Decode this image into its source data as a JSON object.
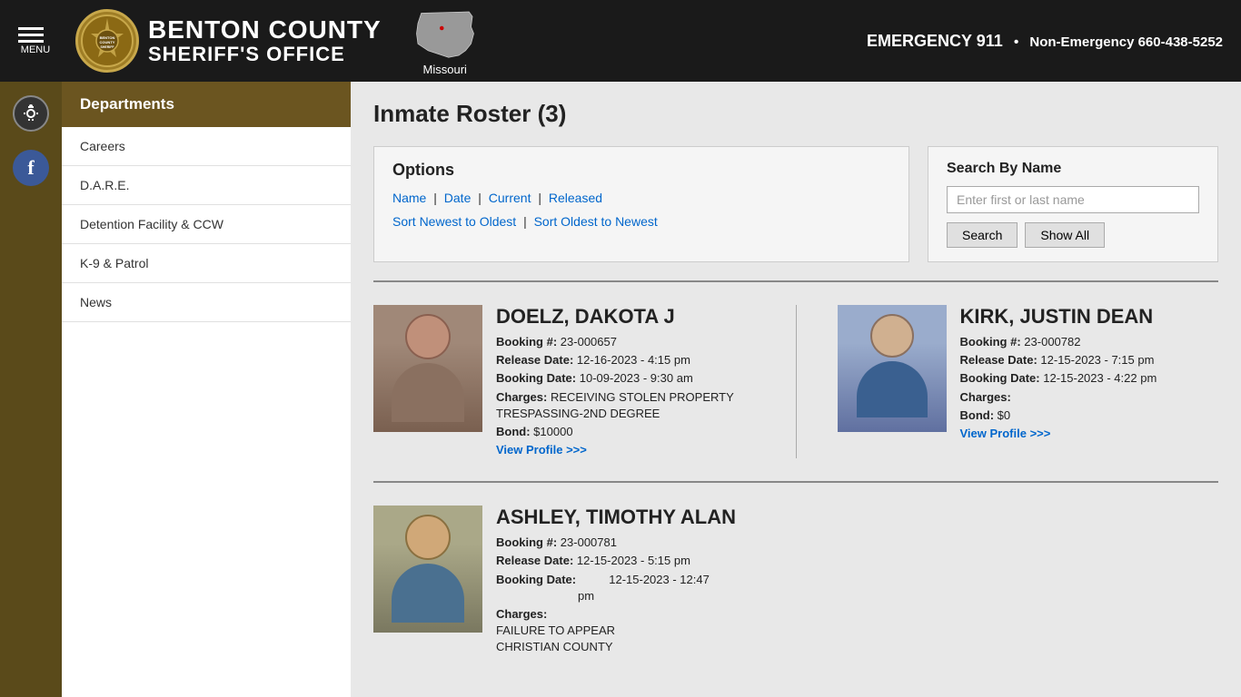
{
  "header": {
    "title_line1": "BENTON COUNTY",
    "title_line2": "SHERIFF'S OFFICE",
    "state": "Missouri",
    "emergency_label": "EMERGENCY 911",
    "separator": "•",
    "non_emergency_label": "Non-Emergency 660-438-5252",
    "menu_label": "MENU"
  },
  "sidebar": {
    "departments_label": "Departments",
    "items": [
      {
        "label": "Careers",
        "href": "#"
      },
      {
        "label": "D.A.R.E.",
        "href": "#"
      },
      {
        "label": "Detention Facility & CCW",
        "href": "#"
      },
      {
        "label": "K-9 & Patrol",
        "href": "#"
      },
      {
        "label": "News",
        "href": "#"
      }
    ]
  },
  "main": {
    "page_title": "Inmate Roster (3)",
    "options": {
      "heading": "Options",
      "links": [
        {
          "label": "Name",
          "href": "#"
        },
        {
          "label": "Date",
          "href": "#"
        },
        {
          "label": "Current",
          "href": "#"
        },
        {
          "label": "Released",
          "href": "#"
        }
      ],
      "sort_links": [
        {
          "label": "Sort Newest to Oldest",
          "href": "#"
        },
        {
          "label": "Sort Oldest to Newest",
          "href": "#"
        }
      ]
    },
    "search": {
      "heading": "Search By Name",
      "placeholder": "Enter first or last name",
      "search_btn": "Search",
      "show_all_btn": "Show All"
    },
    "inmates": [
      {
        "id": "doelz",
        "name": "DOELZ, DAKOTA J",
        "booking_label": "Booking #:",
        "booking": "23-000657",
        "release_label": "Release Date:",
        "release": "12-16-2023 - 4:15 pm",
        "booking_date_label": "Booking Date:",
        "booking_date": "10-09-2023 - 9:30 am",
        "charges_label": "Charges:",
        "charges": "RECEIVING STOLEN PROPERTY\nTRESPASSING-2ND DEGREE",
        "bond_label": "Bond:",
        "bond": "$10000",
        "view_profile": "View Profile >>>",
        "has_photo": true,
        "photo_bg": "#8a7060"
      },
      {
        "id": "kirk",
        "name": "KIRK, JUSTIN DEAN",
        "booking_label": "Booking #:",
        "booking": "23-000782",
        "release_label": "Release Date:",
        "release": "12-15-2023 - 7:15 pm",
        "booking_date_label": "Booking Date:",
        "booking_date": "12-15-2023 - 4:22 pm",
        "charges_label": "Charges:",
        "charges": "",
        "bond_label": "Bond:",
        "bond": "$0",
        "view_profile": "View Profile >>>",
        "has_photo": true,
        "photo_bg": "#5a6a8a"
      },
      {
        "id": "ashley",
        "name": "ASHLEY, TIMOTHY ALAN",
        "booking_label": "Booking #:",
        "booking": "23-000781",
        "release_label": "Release Date:",
        "release": "12-15-2023 - 5:15 pm",
        "booking_date_label": "Booking Date:",
        "booking_date_line1": "12-15-2023 - 12:47",
        "booking_date_line2": "pm",
        "charges_label": "Charges:",
        "charges": "FAILURE TO APPEAR\nCHRISTIAN COUNTY",
        "bond_label": "",
        "bond": "",
        "view_profile": "",
        "has_photo": true,
        "photo_bg": "#7a8060"
      }
    ]
  }
}
